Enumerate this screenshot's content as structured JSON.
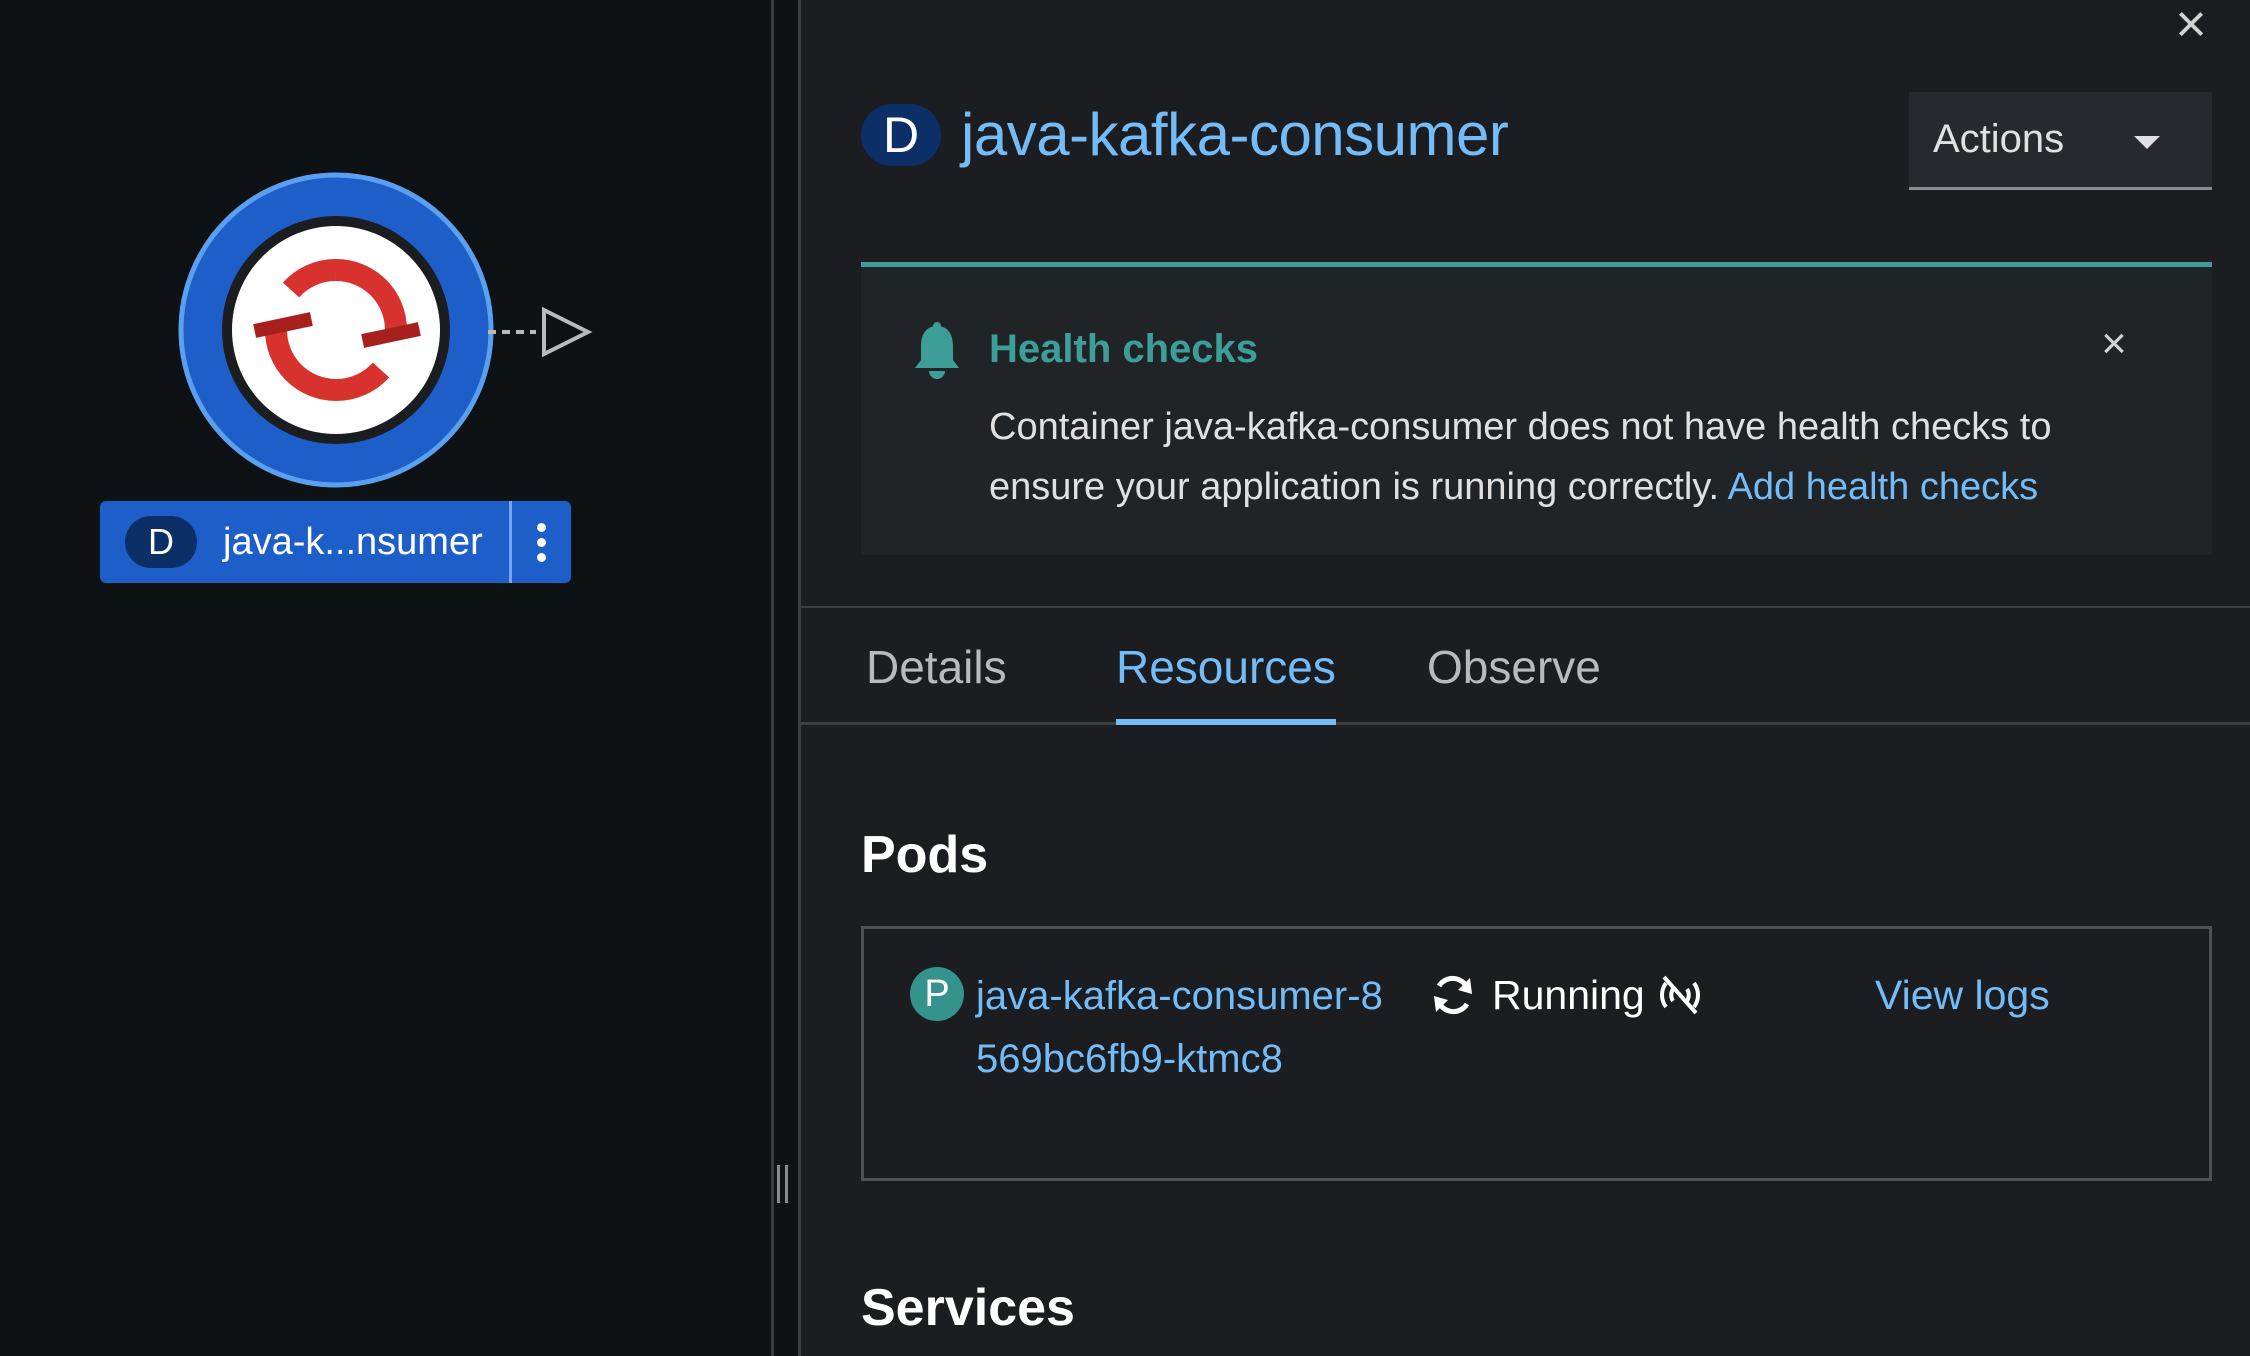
{
  "topology": {
    "node": {
      "kind_badge": "D",
      "label": "java-k...nsumer",
      "icon": "openshift-logo-icon",
      "colors": {
        "ring": "#1e5ec9",
        "ring_outline": "#5ba0f0",
        "logo": "#d8322f"
      }
    }
  },
  "panel": {
    "kind_badge": "D",
    "title": "java-kafka-consumer",
    "actions_label": "Actions",
    "alert": {
      "title": "Health checks",
      "message": "Container java-kafka-consumer does not have health checks to ensure your application is running correctly.",
      "link": "Add health checks",
      "color": "#3d9e99"
    },
    "tabs": [
      {
        "label": "Details",
        "active": false
      },
      {
        "label": "Resources",
        "active": true
      },
      {
        "label": "Observe",
        "active": false
      }
    ],
    "pods": {
      "heading": "Pods",
      "items": [
        {
          "badge": "P",
          "name": "java-kafka-consumer-8569bc6fb9-ktmc8",
          "status": "Running",
          "status_icon": "sync-icon",
          "metrics_icon": "no-signal-icon",
          "logs_link": "View logs"
        }
      ]
    },
    "services": {
      "heading": "Services"
    }
  },
  "colors": {
    "link": "#73bcf7",
    "background": "#1b1d21",
    "canvas": "#0f1214"
  }
}
